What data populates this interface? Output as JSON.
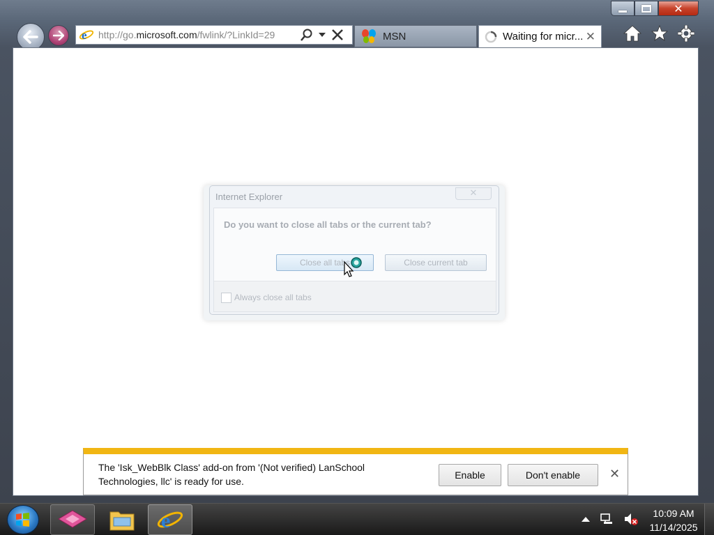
{
  "browser": {
    "address": {
      "prefix": "http://go.",
      "domain": "microsoft.com",
      "path": "/fwlink/?LinkId=29"
    },
    "tabs": [
      {
        "label": "MSN",
        "icon": "msn-butterfly-icon",
        "active": false
      },
      {
        "label": "Waiting for micr...",
        "icon": "loading-spinner-icon",
        "active": true
      }
    ],
    "toolbar_icons": [
      "home-icon",
      "favorites-star-icon",
      "tools-gear-icon"
    ]
  },
  "dialog": {
    "title": "Internet Explorer",
    "question": "Do you want to close all tabs or the current tab?",
    "close_all_label": "Close all tabs",
    "close_current_label": "Close current tab",
    "always_close_label": "Always close all tabs",
    "always_close_checked": false
  },
  "notification": {
    "message": "The 'Isk_WebBlk Class' add-on from '(Not verified) LanSchool Technologies, llc' is ready for use.",
    "enable_label": "Enable",
    "dont_enable_label": "Don't enable",
    "accent_color": "#f1b613"
  },
  "taskbar": {
    "pinned": [
      "start-orb-icon",
      "app-icon",
      "file-explorer-icon",
      "internet-explorer-icon"
    ],
    "time": "10:09 AM",
    "date": "11/14/2025"
  }
}
